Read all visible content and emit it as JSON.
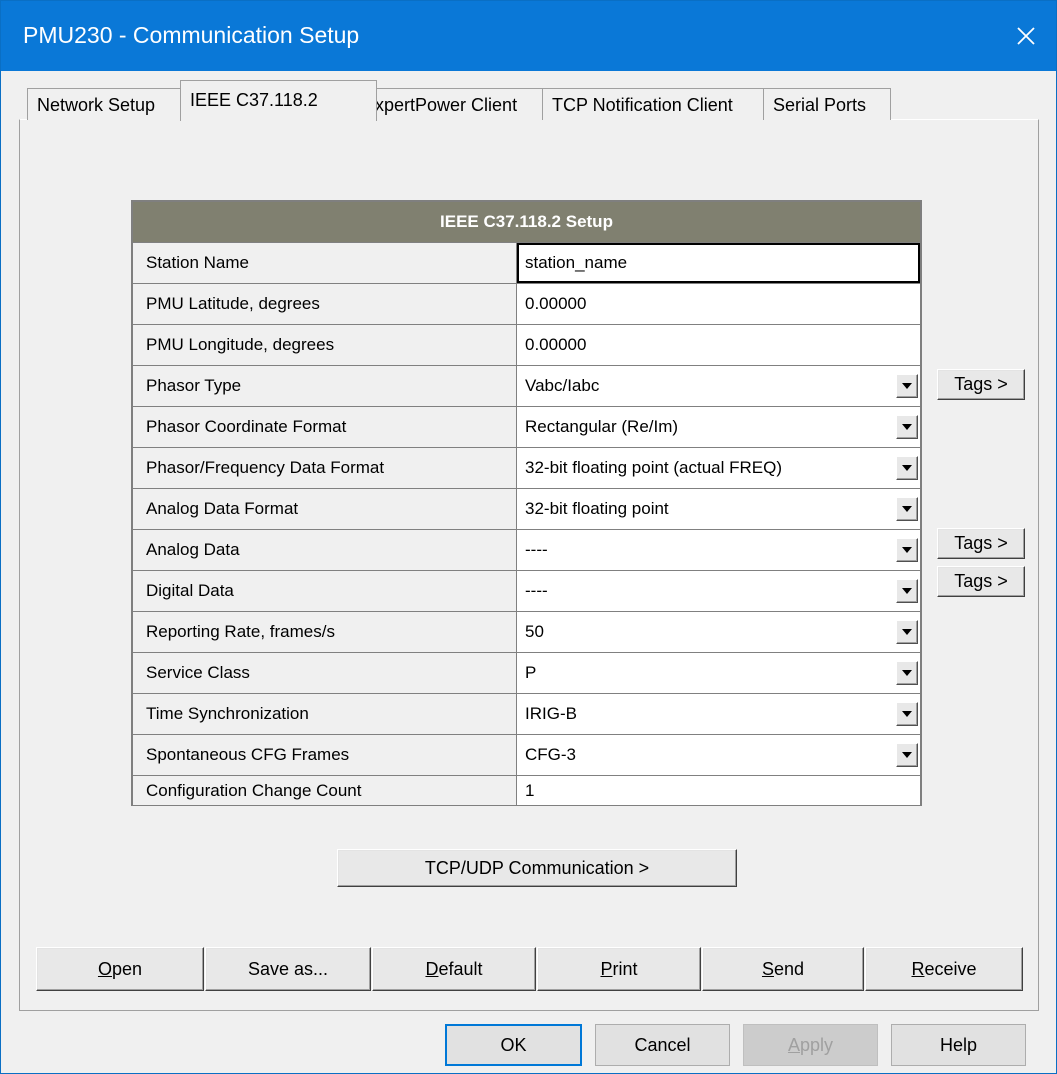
{
  "window": {
    "title": "PMU230 - Communication Setup"
  },
  "tabs": [
    {
      "label": "Network Setup"
    },
    {
      "label": "IEEE C37.118.2"
    },
    {
      "label": "ExpertPower Client"
    },
    {
      "label": "TCP Notification Client"
    },
    {
      "label": "Serial Ports"
    }
  ],
  "active_tab": "IEEE C37.118.2",
  "setup": {
    "header": "IEEE C37.118.2 Setup",
    "rows": [
      {
        "label": "Station Name",
        "value": "station_name"
      },
      {
        "label": "PMU Latitude, degrees",
        "value": "0.00000"
      },
      {
        "label": "PMU Longitude, degrees",
        "value": "0.00000"
      },
      {
        "label": "Phasor Type",
        "value": "Vabc/Iabc"
      },
      {
        "label": "Phasor Coordinate Format",
        "value": "Rectangular (Re/Im)"
      },
      {
        "label": "Phasor/Frequency Data Format",
        "value": "32-bit floating point (actual FREQ)"
      },
      {
        "label": "Analog Data Format",
        "value": "32-bit floating point"
      },
      {
        "label": "Analog Data",
        "value": "----"
      },
      {
        "label": "Digital Data",
        "value": "----"
      },
      {
        "label": "Reporting Rate, frames/s",
        "value": "50"
      },
      {
        "label": "Service Class",
        "value": "P"
      },
      {
        "label": "Time Synchronization",
        "value": "IRIG-B"
      },
      {
        "label": "Spontaneous CFG Frames",
        "value": "CFG-3"
      },
      {
        "label": "Configuration Change Count",
        "value": "1"
      }
    ]
  },
  "tags_label": "Tags >",
  "tcp_udp_label": "TCP/UDP Communication >",
  "file_buttons": {
    "open": {
      "mnemonic": "O",
      "rest": "pen"
    },
    "save_as": {
      "mnemonic": "",
      "rest": "Save as..."
    },
    "default": {
      "mnemonic": "D",
      "rest": "efault"
    },
    "print": {
      "mnemonic": "P",
      "rest": "rint"
    },
    "send": {
      "mnemonic": "S",
      "rest": "end"
    },
    "receive": {
      "mnemonic": "R",
      "rest": "eceive"
    }
  },
  "dialog_buttons": {
    "ok": "OK",
    "cancel": "Cancel",
    "apply": {
      "mnemonic": "A",
      "rest": "pply"
    },
    "help": "Help"
  }
}
